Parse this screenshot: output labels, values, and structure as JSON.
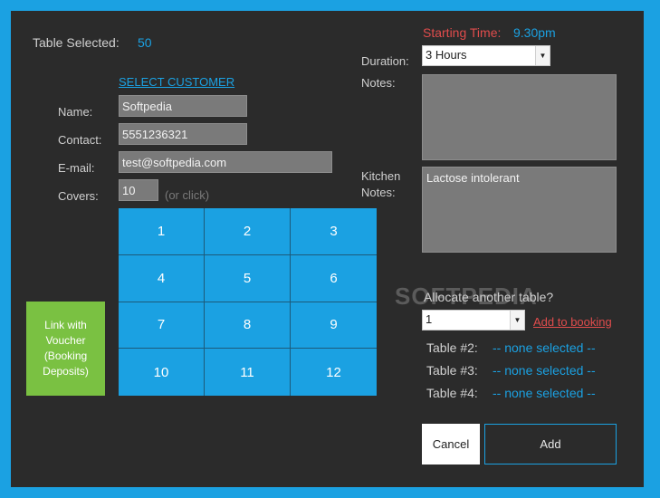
{
  "table_selected": {
    "label": "Table Selected:",
    "value": "50"
  },
  "select_customer": "SELECT CUSTOMER",
  "form": {
    "name_label": "Name:",
    "name_value": "Softpedia",
    "contact_label": "Contact:",
    "contact_value": "5551236321",
    "email_label": "E-mail:",
    "email_value": "test@softpedia.com",
    "covers_label": "Covers:",
    "covers_value": "10",
    "covers_hint": "(or click)"
  },
  "keypad": [
    "1",
    "2",
    "3",
    "4",
    "5",
    "6",
    "7",
    "8",
    "9",
    "10",
    "11",
    "12"
  ],
  "voucher_button": "Link with Voucher (Booking Deposits)",
  "starting_time": {
    "label": "Starting Time:",
    "value": "9.30pm"
  },
  "duration": {
    "label": "Duration:",
    "value": "3 Hours"
  },
  "notes": {
    "label": "Notes:",
    "value": ""
  },
  "kitchen_notes": {
    "label": "Kitchen Notes:",
    "value": "Lactose intolerant"
  },
  "watermark": "SOFTPEDIA",
  "allocate": {
    "label": "Allocate another table?",
    "select_value": "1",
    "add_link": "Add to booking"
  },
  "tables": [
    {
      "label": "Table #2:",
      "value": "-- none selected --"
    },
    {
      "label": "Table #3:",
      "value": "-- none selected --"
    },
    {
      "label": "Table #4:",
      "value": "-- none selected --"
    }
  ],
  "buttons": {
    "cancel": "Cancel",
    "add": "Add"
  },
  "colors": {
    "accent": "#1ba1e2",
    "panel": "#2b2b2b",
    "voucher": "#7ac142",
    "time_label": "#e04c4c"
  }
}
